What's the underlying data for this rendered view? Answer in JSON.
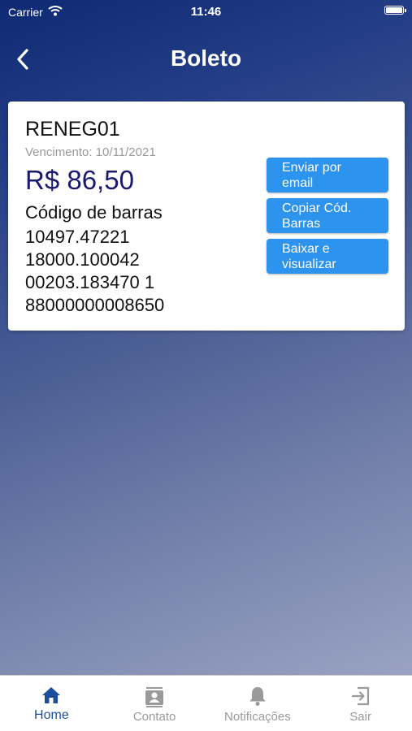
{
  "status_bar": {
    "carrier": "Carrier",
    "time": "11:46"
  },
  "nav": {
    "title": "Boleto"
  },
  "boleto": {
    "id": "RENEG01",
    "due": "Vencimento: 10/11/2021",
    "amount": "R$ 86,50",
    "barcode_label": "Código de barras",
    "barcode_lines": [
      "10497.47221",
      "18000.100042",
      "00203.183470 1",
      "88000000008650"
    ]
  },
  "actions": {
    "email": "Enviar por email",
    "copy": "Copiar Cód. Barras",
    "download": "Baixar e visualizar"
  },
  "tabs": [
    {
      "label": "Home",
      "icon": "home-icon",
      "active": true
    },
    {
      "label": "Contato",
      "icon": "contact-icon",
      "active": false
    },
    {
      "label": "Notificações",
      "icon": "bell-icon",
      "active": false
    },
    {
      "label": "Sair",
      "icon": "exit-icon",
      "active": false
    }
  ],
  "colors": {
    "accent": "#2c93ee",
    "amount": "#1a1a6e",
    "tab_active": "#1c4e9e",
    "tab_inactive": "#9a9a9a"
  }
}
